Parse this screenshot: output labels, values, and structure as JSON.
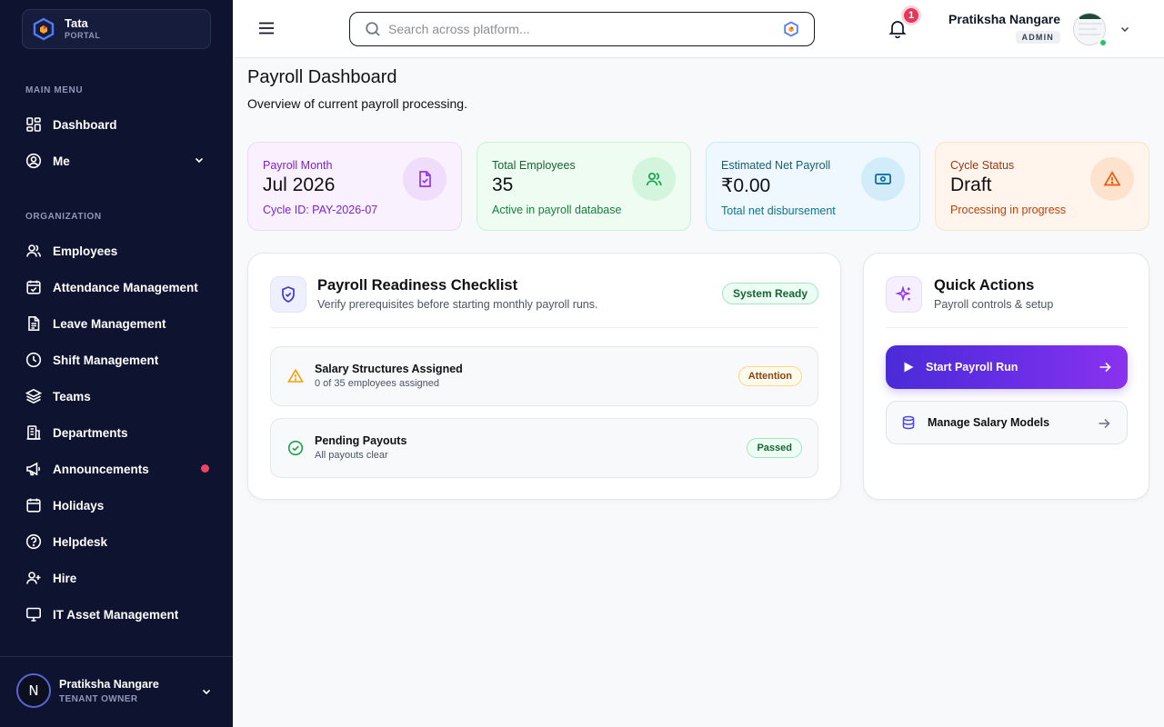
{
  "brand": {
    "name": "Tata",
    "subtitle": "PORTAL"
  },
  "sidebar": {
    "main_menu_label": "MAIN MENU",
    "main_items": [
      {
        "label": "Dashboard",
        "icon": "dashboard-icon"
      },
      {
        "label": "Me",
        "icon": "user-circle-icon",
        "expandable": true
      }
    ],
    "org_label": "ORGANIZATION",
    "org_items": [
      {
        "label": "Employees",
        "icon": "users-icon"
      },
      {
        "label": "Attendance Management",
        "icon": "calendar-check-icon"
      },
      {
        "label": "Leave Management",
        "icon": "document-icon"
      },
      {
        "label": "Shift Management",
        "icon": "clock-icon"
      },
      {
        "label": "Teams",
        "icon": "layers-icon"
      },
      {
        "label": "Departments",
        "icon": "building-icon"
      },
      {
        "label": "Announcements",
        "icon": "megaphone-icon",
        "has_notification": true
      },
      {
        "label": "Holidays",
        "icon": "calendar-icon"
      },
      {
        "label": "Helpdesk",
        "icon": "help-circle-icon"
      },
      {
        "label": "Hire",
        "icon": "user-plus-icon"
      },
      {
        "label": "IT Asset Management",
        "icon": "monitor-icon"
      }
    ],
    "footer": {
      "initial": "N",
      "name": "Pratiksha Nangare",
      "role": "TENANT OWNER"
    }
  },
  "header": {
    "search_placeholder": "Search across platform...",
    "notification_count": "1",
    "user_name": "Pratiksha Nangare",
    "user_role": "ADMIN"
  },
  "page": {
    "title": "Payroll Dashboard",
    "subtitle": "Overview of current payroll processing."
  },
  "stats": [
    {
      "label": "Payroll Month",
      "value": "Jul 2026",
      "sub": "Cycle ID: PAY-2026-07",
      "icon": "file-check-icon",
      "accent": "#7e22ce"
    },
    {
      "label": "Total Employees",
      "value": "35",
      "sub": "Active in payroll database",
      "icon": "users-icon",
      "accent": "#15803d"
    },
    {
      "label": "Estimated Net Payroll",
      "value": "₹0.00",
      "sub": "Total net disbursement",
      "icon": "banknote-icon",
      "accent": "#0e7490"
    },
    {
      "label": "Cycle Status",
      "value": "Draft",
      "sub": "Processing in progress",
      "icon": "alert-triangle-icon",
      "accent": "#c2410c"
    }
  ],
  "checklist": {
    "title": "Payroll Readiness Checklist",
    "subtitle": "Verify prerequisites before starting monthly payroll runs.",
    "status": "System Ready",
    "items": [
      {
        "title": "Salary Structures Assigned",
        "sub": "0 of 35 employees assigned",
        "badge": "Attention",
        "state": "warning"
      },
      {
        "title": "Pending Payouts",
        "sub": "All payouts clear",
        "badge": "Passed",
        "state": "success"
      }
    ]
  },
  "quick_actions": {
    "title": "Quick Actions",
    "subtitle": "Payroll controls & setup",
    "primary": "Start Payroll Run",
    "secondary": "Manage Salary Models"
  }
}
